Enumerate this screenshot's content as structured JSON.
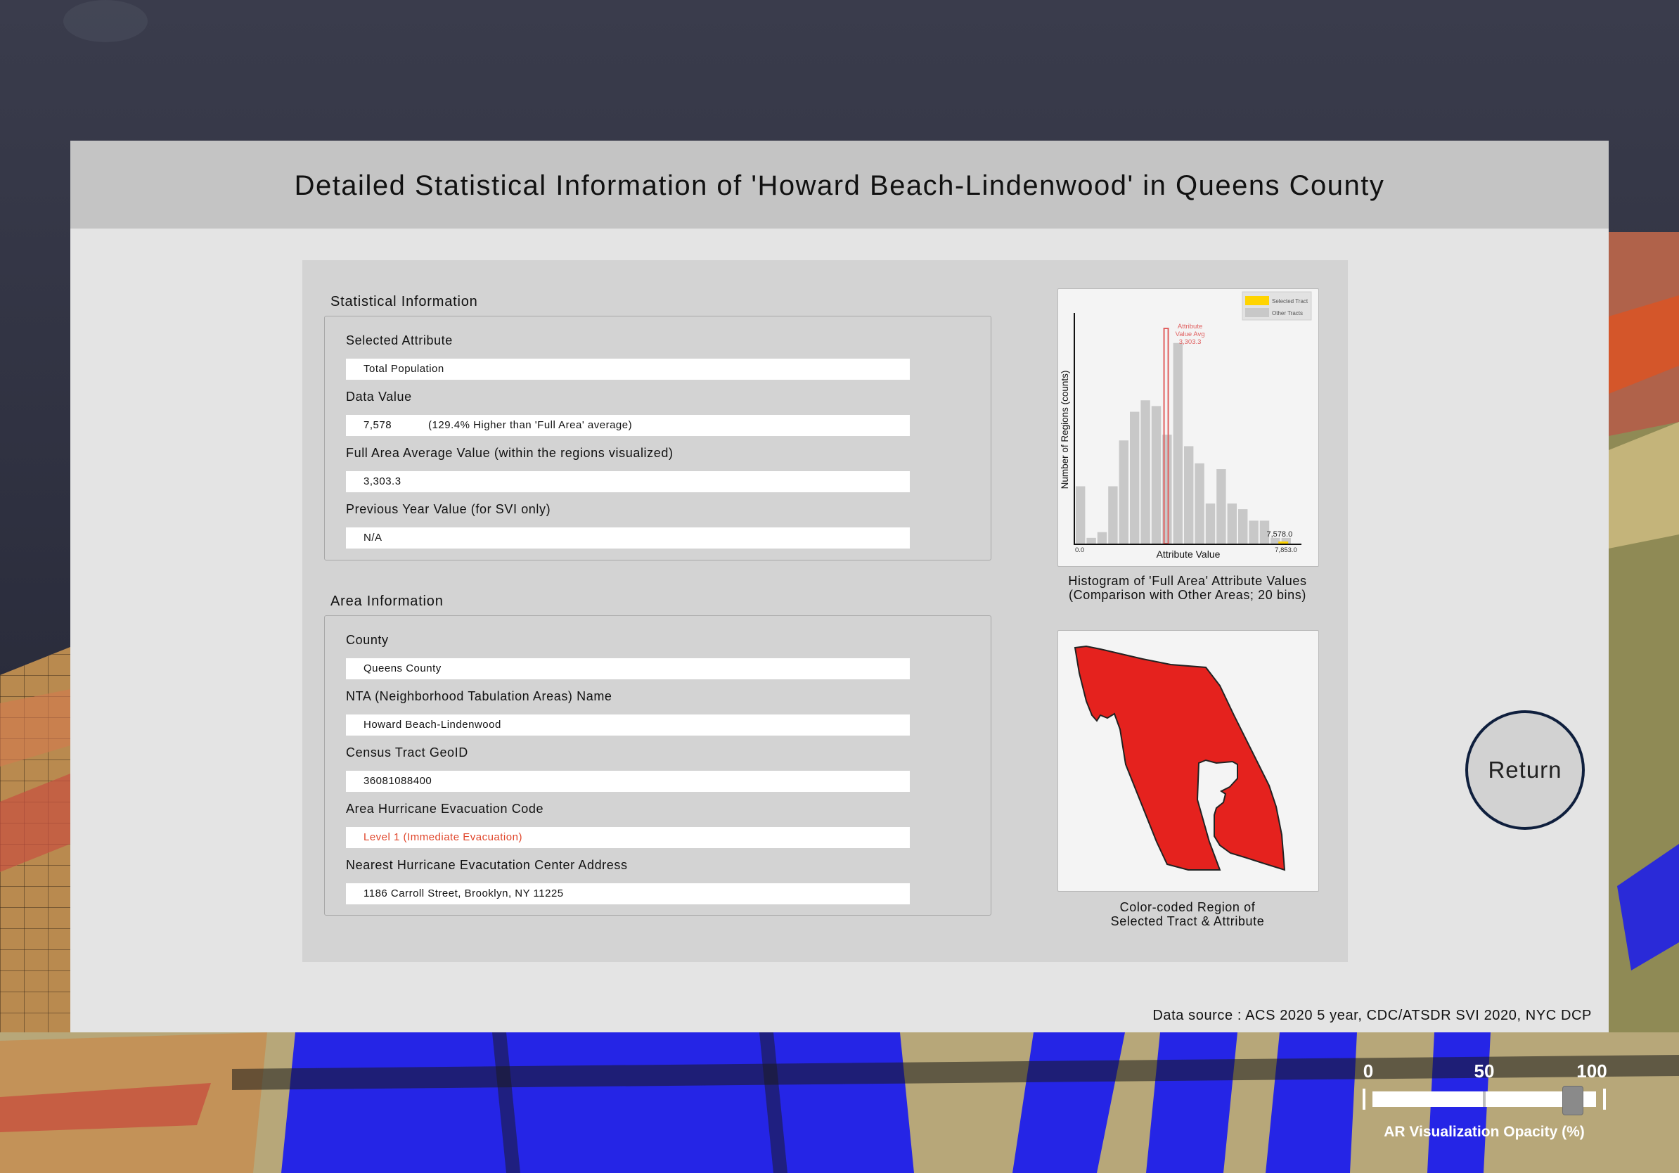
{
  "panel": {
    "title": "Detailed Statistical Information of 'Howard Beach-Lindenwood' in Queens County",
    "data_source": "Data source : ACS 2020 5 year, CDC/ATSDR SVI 2020, NYC DCP"
  },
  "statistical": {
    "section_title": "Statistical Information",
    "selected_attribute": {
      "label": "Selected Attribute",
      "value": "Total Population"
    },
    "data_value": {
      "label": "Data Value",
      "value": "7,578",
      "note": "(129.4% Higher than 'Full Area' average)"
    },
    "full_area_average": {
      "label": "Full Area Average Value (within the regions visualized)",
      "value": "3,303.3"
    },
    "previous_year": {
      "label": "Previous Year Value (for SVI only)",
      "value": "N/A"
    }
  },
  "area": {
    "section_title": "Area Information",
    "county": {
      "label": "County",
      "value": "Queens County"
    },
    "nta_name": {
      "label": "NTA (Neighborhood Tabulation Areas) Name",
      "value": "Howard Beach-Lindenwood"
    },
    "geoid": {
      "label": "Census Tract GeoID",
      "value": "36081088400"
    },
    "evac_code": {
      "label": "Area Hurricane Evacuation Code",
      "value": "Level 1 (Immediate Evacuation)"
    },
    "evac_center": {
      "label": "Nearest Hurricane Evacutation Center Address",
      "value": "1186 Carroll Street, Brooklyn, NY 11225"
    }
  },
  "chart_data": {
    "type": "bar",
    "xlabel": "Attribute Value",
    "ylabel": "Number of Regions (counts)",
    "x_range": [
      0.0,
      7853.0
    ],
    "x_tick_labels": [
      "0.0",
      "7,853.0"
    ],
    "bins": 20,
    "counts": [
      10,
      1,
      2,
      10,
      18,
      23,
      25,
      24,
      19,
      35,
      17,
      14,
      7,
      13,
      7,
      6,
      4,
      4,
      1,
      1
    ],
    "average": 3303.3,
    "average_label": [
      "Attribute",
      "Value Avg",
      "3,303.3"
    ],
    "selected_value": 7578.0,
    "selected_label": "7,578.0",
    "legend": [
      {
        "name": "Selected Tract",
        "color": "#ffd400"
      },
      {
        "name": "Other Tracts",
        "color": "#c8c8c8"
      }
    ],
    "colors": {
      "bars": "#c8c8c8",
      "average_line": "#e06060",
      "selected": "#ffd400"
    },
    "caption_lines": [
      "Histogram of 'Full Area' Attribute Values",
      "(Comparison with Other Areas; 20 bins)"
    ]
  },
  "map": {
    "fill_color": "#e5221e",
    "caption_lines": [
      "Color-coded Region of",
      "Selected Tract & Attribute"
    ]
  },
  "return_button": {
    "label": "Return"
  },
  "opacity_slider": {
    "ticks": [
      "0",
      "50",
      "100"
    ],
    "value": 87,
    "label": "AR Visualization Opacity (%)"
  }
}
